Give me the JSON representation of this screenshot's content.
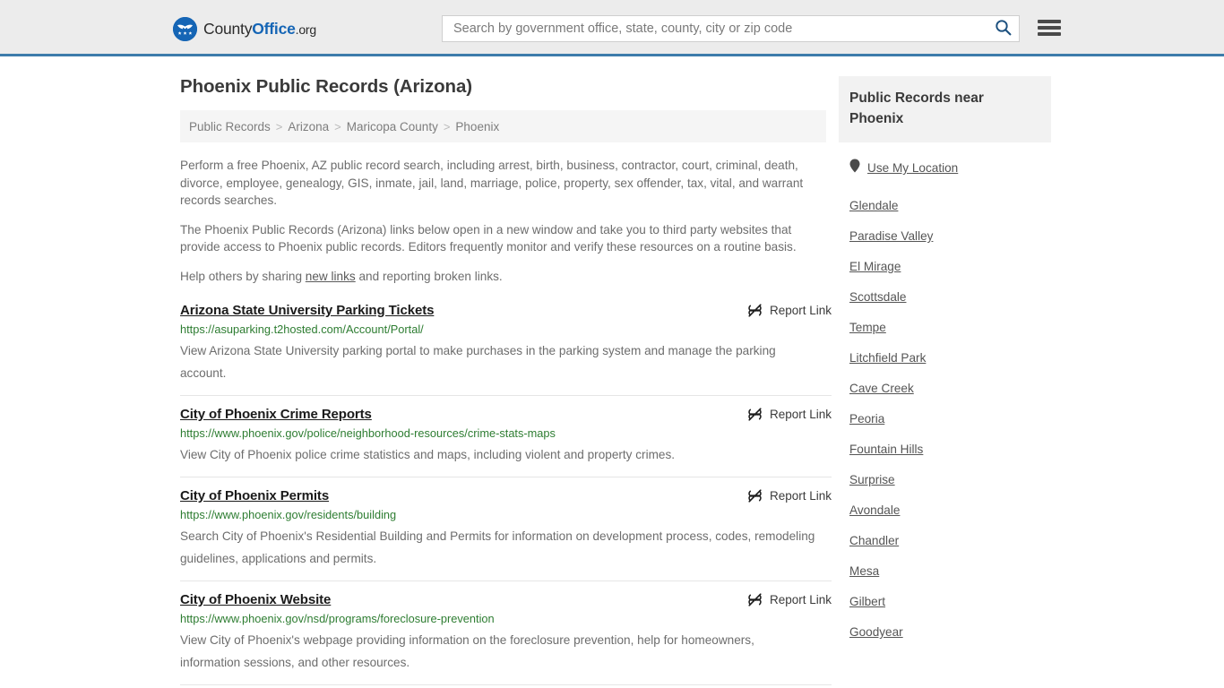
{
  "header": {
    "logo": {
      "text_1": "County",
      "text_2": "Office",
      "text_3": ".org",
      "icon": "eagle-shield-logo-icon"
    },
    "search": {
      "placeholder": "Search by government office, state, county, city or zip code",
      "value": "",
      "search_icon": "search-icon"
    },
    "menu_icon": "hamburger-menu-icon",
    "accent_color": "#3d7cab"
  },
  "main": {
    "title": "Phoenix Public Records (Arizona)",
    "breadcrumb": [
      {
        "label": "Public Records"
      },
      {
        "label": "Arizona"
      },
      {
        "label": "Maricopa County"
      },
      {
        "label": "Phoenix"
      }
    ],
    "breadcrumb_separator": ">",
    "intro_paragraphs": [
      "Perform a free Phoenix, AZ public record search, including arrest, birth, business, contractor, court, criminal, death, divorce, employee, genealogy, GIS, inmate, jail, land, marriage, police, property, sex offender, tax, vital, and warrant records searches.",
      "The Phoenix Public Records (Arizona) links below open in a new window and take you to third party websites that provide access to Phoenix public records. Editors frequently monitor and verify these resources on a routine basis."
    ],
    "help_prefix": "Help others by sharing ",
    "help_link": "new links",
    "help_suffix": " and reporting broken links.",
    "report_label": "Report Link",
    "report_icon": "broken-link-icon",
    "url_color": "#2e7d32",
    "results": [
      {
        "title": "Arizona State University Parking Tickets",
        "url": "https://asuparking.t2hosted.com/Account/Portal/",
        "description": "View Arizona State University parking portal to make purchases in the parking system and manage the parking account."
      },
      {
        "title": "City of Phoenix Crime Reports",
        "url": "https://www.phoenix.gov/police/neighborhood-resources/crime-stats-maps",
        "description": "View City of Phoenix police crime statistics and maps, including violent and property crimes."
      },
      {
        "title": "City of Phoenix Permits",
        "url": "https://www.phoenix.gov/residents/building",
        "description": "Search City of Phoenix's Residential Building and Permits for information on development process, codes, remodeling guidelines, applications and permits."
      },
      {
        "title": "City of Phoenix Website",
        "url": "https://www.phoenix.gov/nsd/programs/foreclosure-prevention",
        "description": "View City of Phoenix's webpage providing information on the foreclosure prevention, help for homeowners, information sessions, and other resources."
      }
    ]
  },
  "sidebar": {
    "heading": "Public Records near Phoenix",
    "use_my_location": "Use My Location",
    "location_icon": "map-pin-icon",
    "cities": [
      {
        "label": "Glendale"
      },
      {
        "label": "Paradise Valley"
      },
      {
        "label": "El Mirage"
      },
      {
        "label": "Scottsdale"
      },
      {
        "label": "Tempe"
      },
      {
        "label": "Litchfield Park"
      },
      {
        "label": "Cave Creek"
      },
      {
        "label": "Peoria"
      },
      {
        "label": "Fountain Hills"
      },
      {
        "label": "Surprise"
      },
      {
        "label": "Avondale"
      },
      {
        "label": "Chandler"
      },
      {
        "label": "Mesa"
      },
      {
        "label": "Gilbert"
      },
      {
        "label": "Goodyear"
      }
    ]
  }
}
